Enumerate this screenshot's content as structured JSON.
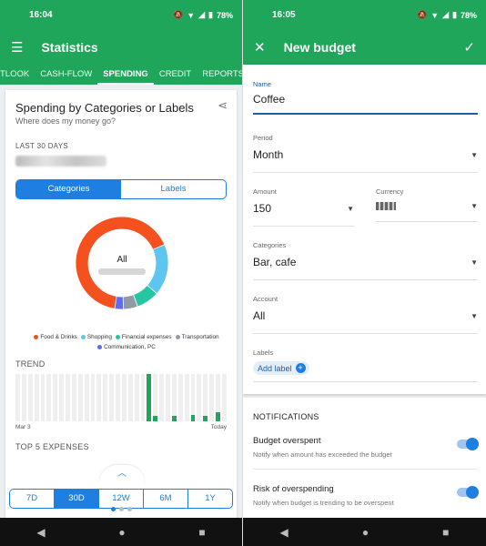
{
  "left": {
    "status": {
      "time": "16:04",
      "battery": "78%"
    },
    "appbar": {
      "title": "Statistics"
    },
    "tabs": [
      "TLOOK",
      "CASH-FLOW",
      "SPENDING",
      "CREDIT",
      "REPORTS"
    ],
    "card": {
      "title": "Spending by Categories or Labels",
      "subtitle": "Where does my money go?",
      "range_label": "LAST 30 DAYS",
      "toggle": {
        "categories": "Categories",
        "labels": "Labels"
      },
      "donut_center": "All",
      "legend": [
        {
          "name": "Food & Drinks",
          "color": "#f4511e"
        },
        {
          "name": "Shopping",
          "color": "#5ec4f0"
        },
        {
          "name": "Financial expenses",
          "color": "#26c6a0"
        },
        {
          "name": "Transportation",
          "color": "#8e9aa6"
        },
        {
          "name": "Communication, PC",
          "color": "#5c6bf0"
        }
      ],
      "trend_label": "TREND",
      "trend_start": "Mar 3",
      "trend_end": "Today",
      "top_label": "TOP 5 EXPENSES"
    },
    "periods": [
      "7D",
      "30D",
      "12W",
      "6M",
      "1Y"
    ]
  },
  "right": {
    "status": {
      "time": "16:05",
      "battery": "78%"
    },
    "appbar": {
      "title": "New budget"
    },
    "fields": {
      "name_label": "Name",
      "name_value": "Coffee",
      "period_label": "Period",
      "period_value": "Month",
      "amount_label": "Amount",
      "amount_value": "150",
      "currency_label": "Currency",
      "categories_label": "Categories",
      "categories_value": "Bar, cafe",
      "account_label": "Account",
      "account_value": "All",
      "labels_label": "Labels",
      "add_label": "Add label"
    },
    "notifications": {
      "heading": "NOTIFICATIONS",
      "overspent_title": "Budget overspent",
      "overspent_desc": "Notify when amount has exceeded the budget",
      "risk_title": "Risk of overspending",
      "risk_desc": "Notify when budget is trending to be overspent"
    }
  },
  "chart_data": [
    {
      "type": "pie",
      "categories": [
        "Food & Drinks",
        "Shopping",
        "Financial expenses",
        "Transportation",
        "Communication, PC"
      ],
      "values": [
        66,
        18,
        8,
        5,
        3
      ],
      "colors": [
        "#f4511e",
        "#5ec4f0",
        "#26c6a0",
        "#8e9aa6",
        "#5c6bf0"
      ]
    },
    {
      "type": "bar",
      "x": [
        "Mar 3",
        "Today"
      ],
      "values": [
        0,
        0,
        0,
        0,
        0,
        0,
        0,
        0,
        0,
        0,
        0,
        0,
        0,
        0,
        0,
        0,
        0,
        0,
        0,
        0,
        0,
        1.0,
        0.12,
        0,
        0,
        0.12,
        0,
        0,
        0.14,
        0,
        0.12,
        0,
        0.2,
        0
      ],
      "xlabel": "",
      "ylabel": ""
    }
  ]
}
